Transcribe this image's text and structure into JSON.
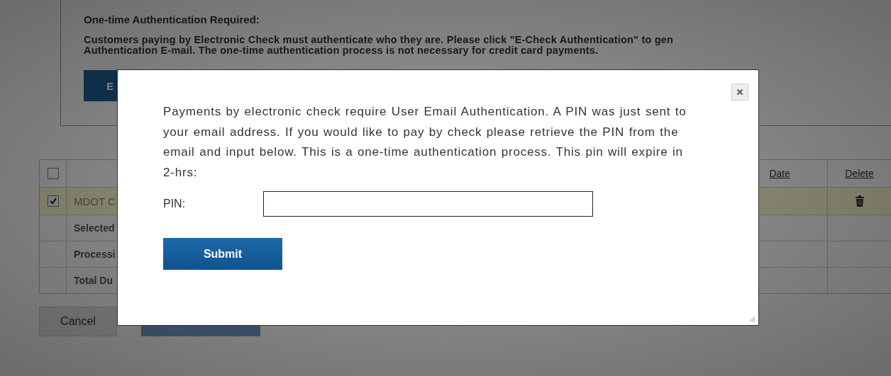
{
  "notice": {
    "title": "One-time Authentication Required:",
    "text_lines": [
      "Customers paying by Electronic Check must authenticate who they are. Please click \"E-Check Authentication\" to gen",
      "Authentication E-mail. The one-time authentication process is not necessary for credit card payments."
    ],
    "button_label": "E"
  },
  "table": {
    "header": {
      "checked": false,
      "date_label": "Date",
      "delete_label": "Delete"
    },
    "rows": [
      {
        "kind": "item",
        "label": "MDOT C",
        "checked": true
      },
      {
        "kind": "summary",
        "label": "Selected"
      },
      {
        "kind": "summary",
        "label": "Processi"
      },
      {
        "kind": "summary",
        "label": "Total Du"
      }
    ]
  },
  "actions": {
    "cancel_label": "Cancel"
  },
  "modal": {
    "message": "Payments by electronic check require User Email Authentication. A PIN was just sent to your email address. If you would like to pay by check please retrieve the PIN from the email and input below. This is a one-time authentication process. This pin will expire in 2-hrs:",
    "pin_label": "PIN:",
    "submit_label": "Submit"
  }
}
